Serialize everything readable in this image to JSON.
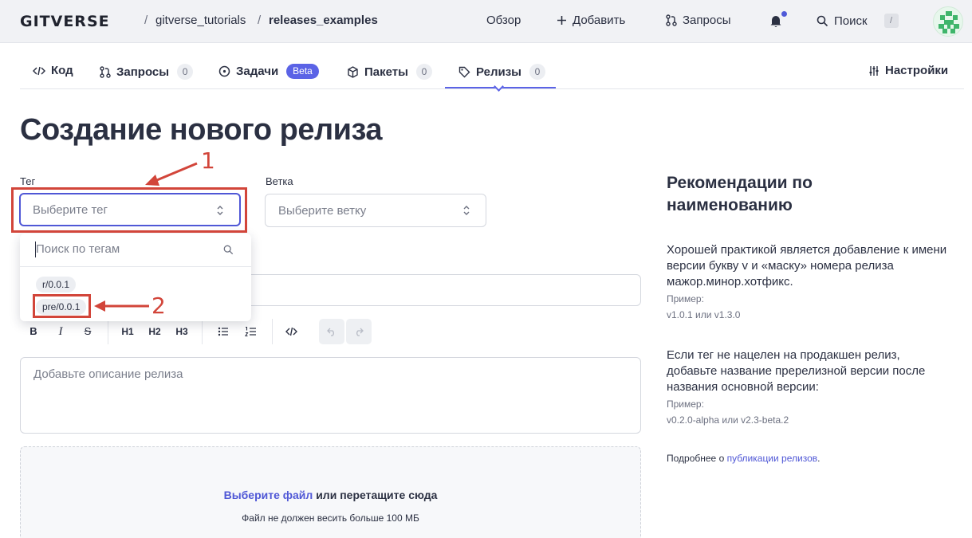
{
  "header": {
    "logo": "GITVERSE",
    "breadcrumb": {
      "owner": "gitverse_tutorials",
      "separator": "/",
      "repo": "releases_examples"
    },
    "nav": {
      "overview": "Обзор",
      "add": "Добавить",
      "requests": "Запросы",
      "search": "Поиск",
      "search_shortcut": "/"
    }
  },
  "tabs": [
    {
      "label": "Код"
    },
    {
      "label": "Запросы",
      "count": "0"
    },
    {
      "label": "Задачи",
      "badge": "Beta"
    },
    {
      "label": "Пакеты",
      "count": "0"
    },
    {
      "label": "Релизы",
      "count": "0",
      "active": true
    },
    {
      "label": "Настройки"
    }
  ],
  "page": {
    "title": "Создание нового релиза"
  },
  "form": {
    "tag_label": "Тег",
    "tag_placeholder": "Выберите тег",
    "branch_label": "Ветка",
    "branch_placeholder": "Выберите ветку",
    "tag_dropdown": {
      "search_placeholder": "Поиск по тегам",
      "options": [
        "r/0.0.1",
        "pre/0.0.1"
      ]
    },
    "description_placeholder": "Добавьте описание релиза",
    "toolbar": {
      "bold": "B",
      "italic": "I",
      "strike": "S",
      "h1": "H1",
      "h2": "H2",
      "h3": "H3"
    },
    "upload": {
      "link": "Выберите файл",
      "text": " или перетащите сюда",
      "limit": "Файл не должен весить больше 100 МБ"
    }
  },
  "sidebar": {
    "title": "Рекомендации по наименованию",
    "p1": "Хорошей практикой является добавление к имени версии букву v и «маску» номера релиза мажор.минор.хотфикс.",
    "example_label": "Пример:",
    "example1": "v1.0.1 или v1.3.0",
    "p2": "Если тег не нацелен на продакшен релиз, добавьте название пререлизной версии после названия основной версии:",
    "example2": "v0.2.0-alpha или v2.3-beta.2",
    "more_prefix": "Подробнее о ",
    "more_link": "публикации релизов",
    "more_suffix": "."
  },
  "annotations": {
    "first": "1",
    "second": "2",
    "color": "#d2453a"
  },
  "colors": {
    "accent": "#5b63e6",
    "text": "#2b3042",
    "annotation": "#d2453a"
  }
}
